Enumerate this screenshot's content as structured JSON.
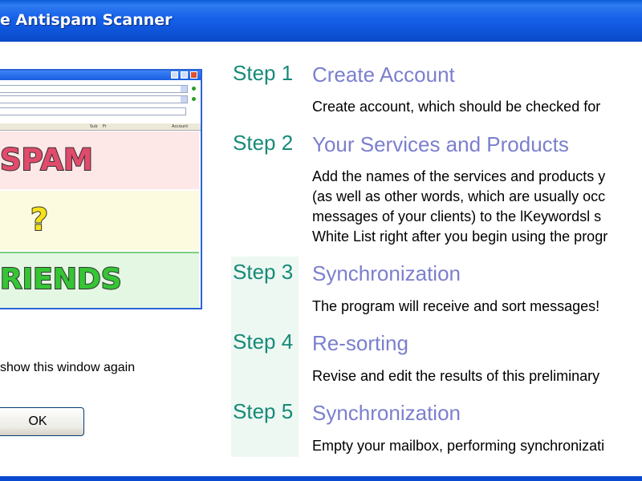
{
  "window": {
    "title": "e Antispam Scanner"
  },
  "illustration": {
    "spam_label": "SPAM",
    "unknown_label": "?",
    "friends_label": "RIENDS",
    "header_cols": [
      "Sub",
      "Fr",
      "Account"
    ]
  },
  "options": {
    "show_again_label": "show this window again",
    "ok_label": "OK"
  },
  "steps": [
    {
      "number": "Step 1",
      "title": "Create Account",
      "lines": [
        "Create account, which should be checked for"
      ]
    },
    {
      "number": "Step 2",
      "title": "Your Services and Products",
      "lines": [
        "Add the names of the services and products y",
        "(as well as other words, which are usually occ",
        "messages of your clients) to the lKeywordsl s",
        "White List right after you begin using the progr"
      ]
    },
    {
      "number": "Step 3",
      "title": "Synchronization",
      "lines": [
        "The program will receive and sort messages!"
      ]
    },
    {
      "number": "Step 4",
      "title": "Re-sorting",
      "lines": [
        "Revise and edit the results of this preliminary"
      ]
    },
    {
      "number": "Step 5",
      "title": "Synchronization",
      "lines": [
        "Empty your mailbox, performing synchronizati"
      ]
    }
  ],
  "colors": {
    "title_bar": "#0d52d6",
    "step_number": "#178a78",
    "step_heading": "#7b7fce",
    "spam_text": "#e24a6b",
    "unknown_text": "#f5e21a",
    "friends_text": "#35c535"
  }
}
